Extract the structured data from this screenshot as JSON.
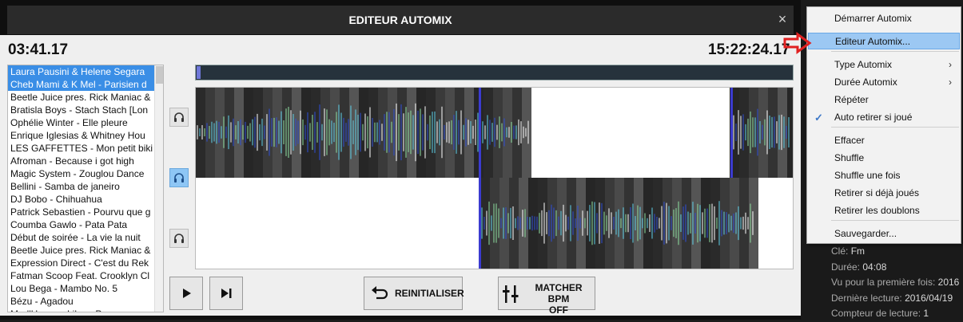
{
  "window": {
    "title": "EDITEUR AUTOMIX",
    "close_glyph": "×"
  },
  "timers": {
    "left": "03:41.17",
    "right": "15:22:24.17"
  },
  "tracks": [
    "Laura Pausini & Helene Segara",
    " Cheb Mami &  K Mel - Parisien d",
    "Beetle Juice pres. Rick Maniac &",
    "Bratisla Boys - Stach Stach [Lon",
    "Ophélie Winter - Elle pleure",
    "Enrique Iglesias &  Whitney Hou",
    "LES GAFFETTES - Mon petit biki",
    "Afroman - Because i got high",
    "Magic System - Zouglou Dance",
    "Bellini - Samba de janeiro",
    "DJ Bobo - Chihuahua",
    "Patrick Sebastien - Pourvu que g",
    "Coumba Gawlo - Pata Pata",
    "Début de soirée - La vie la nuit",
    "Beetle Juice pres. Rick Maniac &",
    "Expression Direct - C'est du Rek",
    "Fatman Scoop Feat. Crooklyn Cl",
    "Lou Bega - Mambo No. 5",
    "Bézu - Agadou",
    "Mad'House - Like a Prayer"
  ],
  "buttons": {
    "reset": "REINITIALISER",
    "bpm_line1": "MATCHER BPM",
    "bpm_line2": "OFF"
  },
  "menu": {
    "items": [
      {
        "label": "Démarrer Automix"
      },
      {
        "label": "Editeur Automix..."
      },
      {
        "label": "Type Automix",
        "submenu": "›"
      },
      {
        "label": "Durée Automix",
        "submenu": "›"
      },
      {
        "label": "Répéter"
      },
      {
        "label": "Auto retirer si joué",
        "check": "✓"
      },
      {
        "label": "Effacer"
      },
      {
        "label": "Shuffle"
      },
      {
        "label": "Shuffle une fois"
      },
      {
        "label": "Retirer si déjà joués"
      },
      {
        "label": "Retirer les doublons"
      },
      {
        "label": "Sauvegarder..."
      }
    ]
  },
  "info": {
    "key_label": "Clé:",
    "key_value": "Fm",
    "duration_label": "Durée:",
    "duration_value": "04:08",
    "first_seen_label": "Vu pour la première fois:",
    "first_seen_value": "2016",
    "last_played_label": "Dernière lecture:",
    "last_played_value": "2016/04/19",
    "play_count_label": "Compteur de lecture:",
    "play_count_value": "1"
  },
  "colors": {
    "accent": "#3a8ee6",
    "highlight": "#9cc8f3",
    "wave_dark": "#1e1e1e",
    "wave_blue": "#2f4fd8",
    "wave_cyan": "#5fd0e8",
    "marker": "#3b3bd0",
    "annotation_red": "#e02020"
  },
  "icons": {
    "play": "play-icon",
    "next": "skip-next-icon",
    "reset": "undo-arrow-icon",
    "bpm": "bpm-match-icon",
    "headphones": "headphones-icon"
  }
}
